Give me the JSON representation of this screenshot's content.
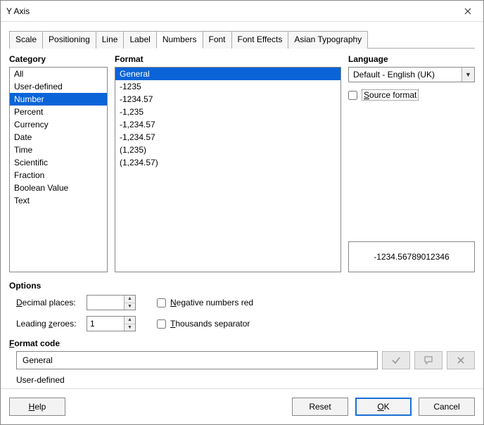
{
  "window": {
    "title": "Y Axis"
  },
  "tabs": [
    {
      "label": "Scale",
      "active": false
    },
    {
      "label": "Positioning",
      "active": false
    },
    {
      "label": "Line",
      "active": false
    },
    {
      "label": "Label",
      "active": false
    },
    {
      "label": "Numbers",
      "active": true
    },
    {
      "label": "Font",
      "active": false
    },
    {
      "label": "Font Effects",
      "active": false
    },
    {
      "label": "Asian Typography",
      "active": false
    }
  ],
  "category": {
    "heading": "Category",
    "items": [
      "All",
      "User-defined",
      "Number",
      "Percent",
      "Currency",
      "Date",
      "Time",
      "Scientific",
      "Fraction",
      "Boolean Value",
      "Text"
    ],
    "selected_index": 2
  },
  "format": {
    "heading": "Format",
    "items": [
      "General",
      "-1235",
      "-1234.57",
      "-1,235",
      "-1,234.57",
      "-1,234.57",
      "(1,235)",
      "(1,234.57)"
    ],
    "selected_index": 0
  },
  "language": {
    "heading": "Language",
    "selected": "Default - English (UK)",
    "source_format_label": "Source format",
    "source_format_checked": false
  },
  "preview": {
    "value": "-1234.56789012346"
  },
  "options": {
    "heading": "Options",
    "decimal_places_label": "Decimal places:",
    "decimal_places_value": "",
    "leading_zeroes_label": "Leading zeroes:",
    "leading_zeroes_value": "1",
    "negative_red_label": "Negative numbers red",
    "negative_red_checked": false,
    "thousands_label": "Thousands separator",
    "thousands_checked": false
  },
  "format_code": {
    "heading": "Format code",
    "value": "General",
    "note": "User-defined"
  },
  "buttons": {
    "help": "Help",
    "reset": "Reset",
    "ok": "OK",
    "cancel": "Cancel"
  }
}
